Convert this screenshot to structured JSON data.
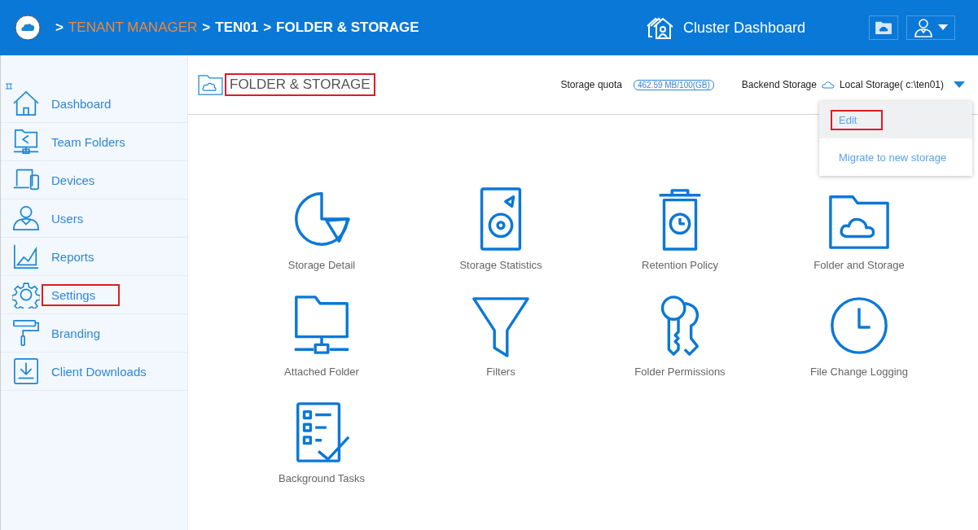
{
  "header": {
    "breadcrumbs": [
      {
        "separator": ">",
        "label": "TENANT MANAGER",
        "link": true
      },
      {
        "separator": ">",
        "label": "TEN01",
        "link": false
      },
      {
        "separator": ">",
        "label": "FOLDER & STORAGE",
        "link": false
      }
    ],
    "cluster_link": "Cluster Dashboard"
  },
  "sidebar": {
    "items": [
      {
        "label": "Dashboard",
        "highlighted": false
      },
      {
        "label": "Team Folders",
        "highlighted": false
      },
      {
        "label": "Devices",
        "highlighted": false
      },
      {
        "label": "Users",
        "highlighted": false
      },
      {
        "label": "Reports",
        "highlighted": false
      },
      {
        "label": "Settings",
        "highlighted": true
      },
      {
        "label": "Branding",
        "highlighted": false
      },
      {
        "label": "Client Downloads",
        "highlighted": false
      }
    ]
  },
  "page": {
    "title": "FOLDER & STORAGE",
    "title_highlighted": true,
    "storage_quota_label": "Storage quota",
    "storage_quota": "462.59 MB/100(GB)",
    "backend_storage_label": "Backend Storage",
    "backend_storage": "Local Storage( c:\\ten01)",
    "dropdown": [
      {
        "label": "Edit",
        "highlighted": true,
        "hovered": true
      },
      {
        "label": "Migrate to new storage",
        "highlighted": false,
        "hovered": false
      }
    ],
    "tiles": [
      {
        "label": "Storage Detail"
      },
      {
        "label": "Storage Statistics"
      },
      {
        "label": "Retention Policy"
      },
      {
        "label": "Folder and Storage"
      },
      {
        "label": "Attached Folder"
      },
      {
        "label": "Filters"
      },
      {
        "label": "Folder Permissions"
      },
      {
        "label": "File Change Logging"
      },
      {
        "label": "Background Tasks"
      }
    ]
  }
}
